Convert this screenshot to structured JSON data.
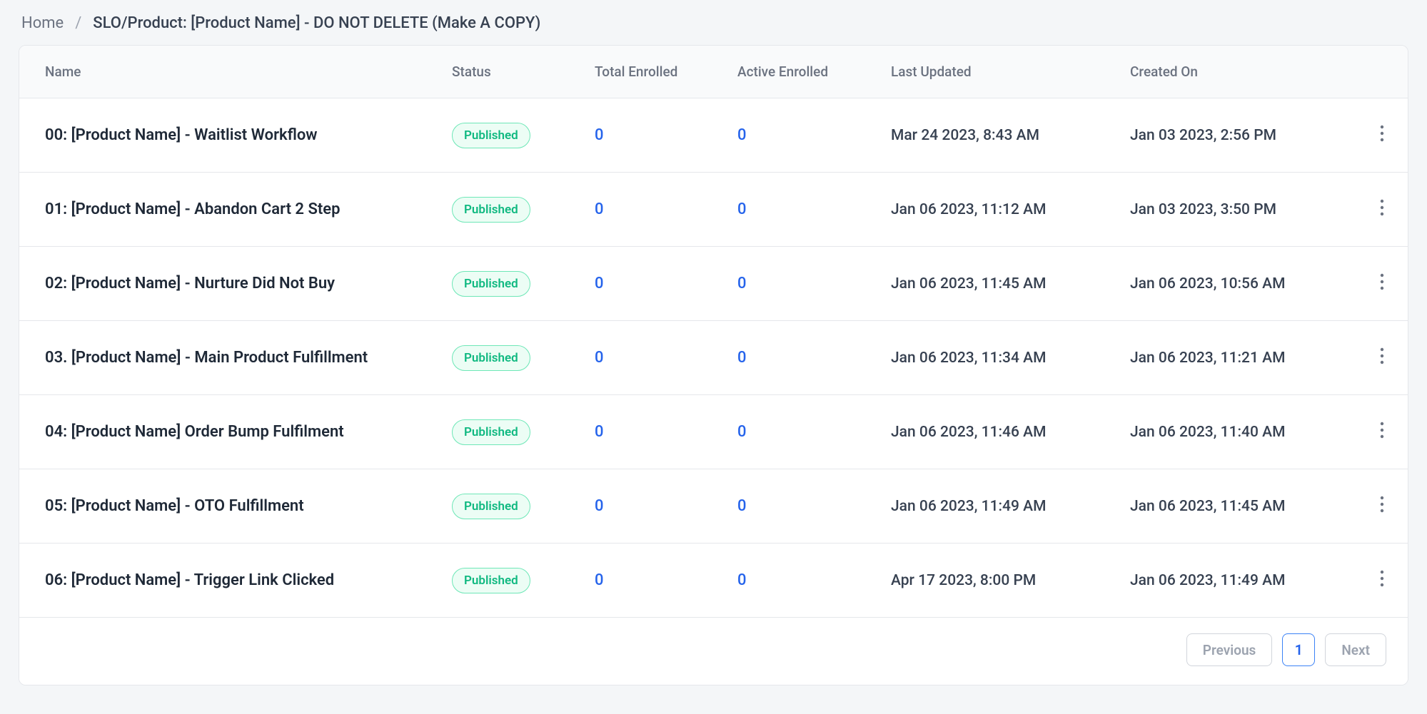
{
  "breadcrumb": {
    "home": "Home",
    "current": "SLO/Product: [Product Name] - DO NOT DELETE (Make A COPY)"
  },
  "columns": {
    "name": "Name",
    "status": "Status",
    "total": "Total Enrolled",
    "active": "Active Enrolled",
    "updated": "Last Updated",
    "created": "Created On"
  },
  "status_label": "Published",
  "rows": [
    {
      "name": "00: [Product Name] - Waitlist Workflow",
      "total": "0",
      "active": "0",
      "updated": "Mar 24 2023, 8:43 AM",
      "created": "Jan 03 2023, 2:56 PM"
    },
    {
      "name": "01: [Product Name] - Abandon Cart 2 Step",
      "total": "0",
      "active": "0",
      "updated": "Jan 06 2023, 11:12 AM",
      "created": "Jan 03 2023, 3:50 PM"
    },
    {
      "name": "02: [Product Name] - Nurture Did Not Buy",
      "total": "0",
      "active": "0",
      "updated": "Jan 06 2023, 11:45 AM",
      "created": "Jan 06 2023, 10:56 AM"
    },
    {
      "name": "03. [Product Name] - Main Product Fulfillment",
      "total": "0",
      "active": "0",
      "updated": "Jan 06 2023, 11:34 AM",
      "created": "Jan 06 2023, 11:21 AM"
    },
    {
      "name": "04: [Product Name] Order Bump Fulfilment",
      "total": "0",
      "active": "0",
      "updated": "Jan 06 2023, 11:46 AM",
      "created": "Jan 06 2023, 11:40 AM"
    },
    {
      "name": "05: [Product Name] - OTO Fulfillment",
      "total": "0",
      "active": "0",
      "updated": "Jan 06 2023, 11:49 AM",
      "created": "Jan 06 2023, 11:45 AM"
    },
    {
      "name": "06: [Product Name] - Trigger Link Clicked",
      "total": "0",
      "active": "0",
      "updated": "Apr 17 2023, 8:00 PM",
      "created": "Jan 06 2023, 11:49 AM"
    }
  ],
  "pagination": {
    "prev": "Previous",
    "page": "1",
    "next": "Next"
  }
}
